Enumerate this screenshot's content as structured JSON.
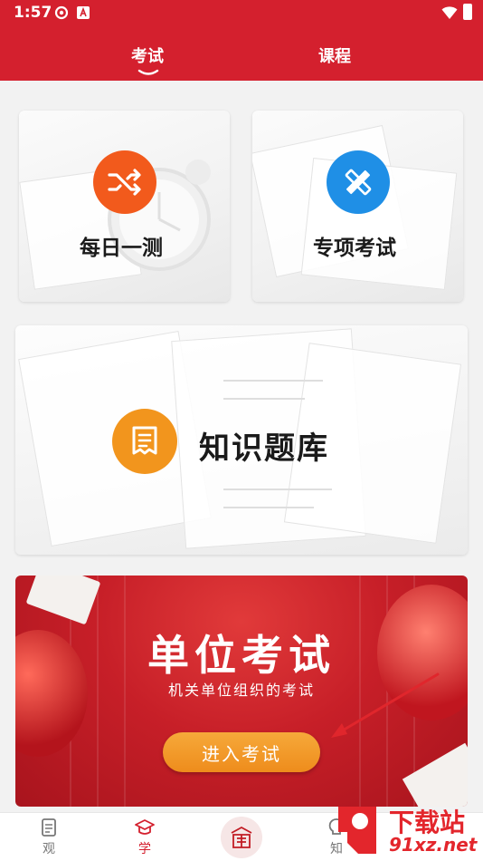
{
  "status_bar": {
    "time": "1:57"
  },
  "header": {
    "tabs": [
      {
        "label": "考试",
        "active": true
      },
      {
        "label": "课程",
        "active": false
      }
    ]
  },
  "cards": {
    "daily": {
      "label": "每日一测",
      "icon": "shuffle-icon",
      "color": "#f25a1c"
    },
    "topic": {
      "label": "专项考试",
      "icon": "pencil-ruler-icon",
      "color": "#1f8fe6"
    },
    "bank": {
      "label": "知识题库",
      "icon": "document-list-icon",
      "color": "#f2951d"
    }
  },
  "exam_banner": {
    "title": "单位考试",
    "subtitle": "机关单位组织的考试",
    "button_label": "进入考试"
  },
  "bottom_nav": {
    "items": [
      {
        "label": "观",
        "icon": "document-icon",
        "active": false
      },
      {
        "label": "学",
        "icon": "graduation-cap-icon",
        "active": true
      },
      {
        "label": "",
        "icon": "seal-logo-icon",
        "active": false
      },
      {
        "label": "知",
        "icon": "lightbulb-icon",
        "active": false
      }
    ]
  },
  "watermark": {
    "line1": "下载站",
    "line2": "91xz.net"
  },
  "colors": {
    "brand_red": "#d4202e",
    "button_orange": "#ee8c1c"
  }
}
